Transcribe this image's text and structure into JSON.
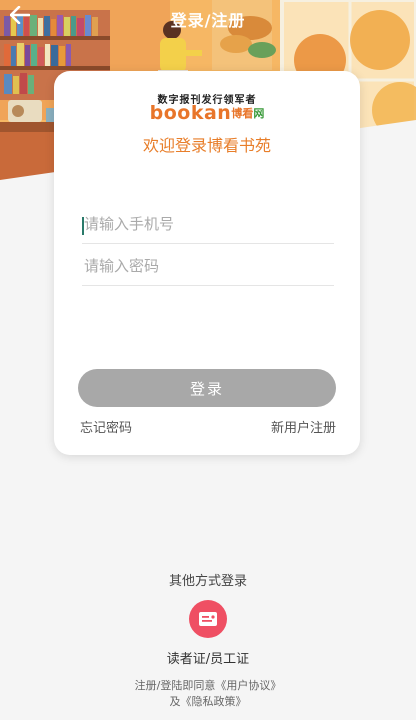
{
  "nav": {
    "title": "登录/注册",
    "back_icon": "arrow-left-icon"
  },
  "card": {
    "slogan": "数字报刊发行领军者",
    "brand_en": "bookan",
    "brand_cn_1": "博看",
    "brand_cn_2": "网",
    "welcome": "欢迎登录博看书苑",
    "phone_placeholder": "请输入手机号",
    "phone_value": "",
    "password_placeholder": "请输入密码",
    "password_value": "",
    "login_label": "登录",
    "forgot_label": "忘记密码",
    "register_label": "新用户注册"
  },
  "other": {
    "title": "其他方式登录",
    "option_icon": "id-card-icon",
    "option_label": "读者证/员工证"
  },
  "agreement": {
    "prefix": "注册/登陆即同意",
    "user_agreement": "《用户协议》",
    "and": "及",
    "privacy_policy": "《隐私政策》"
  },
  "colors": {
    "accent": "#e87e2a",
    "button_disabled": "#a8a8a8",
    "other_login": "#ef4f63"
  }
}
